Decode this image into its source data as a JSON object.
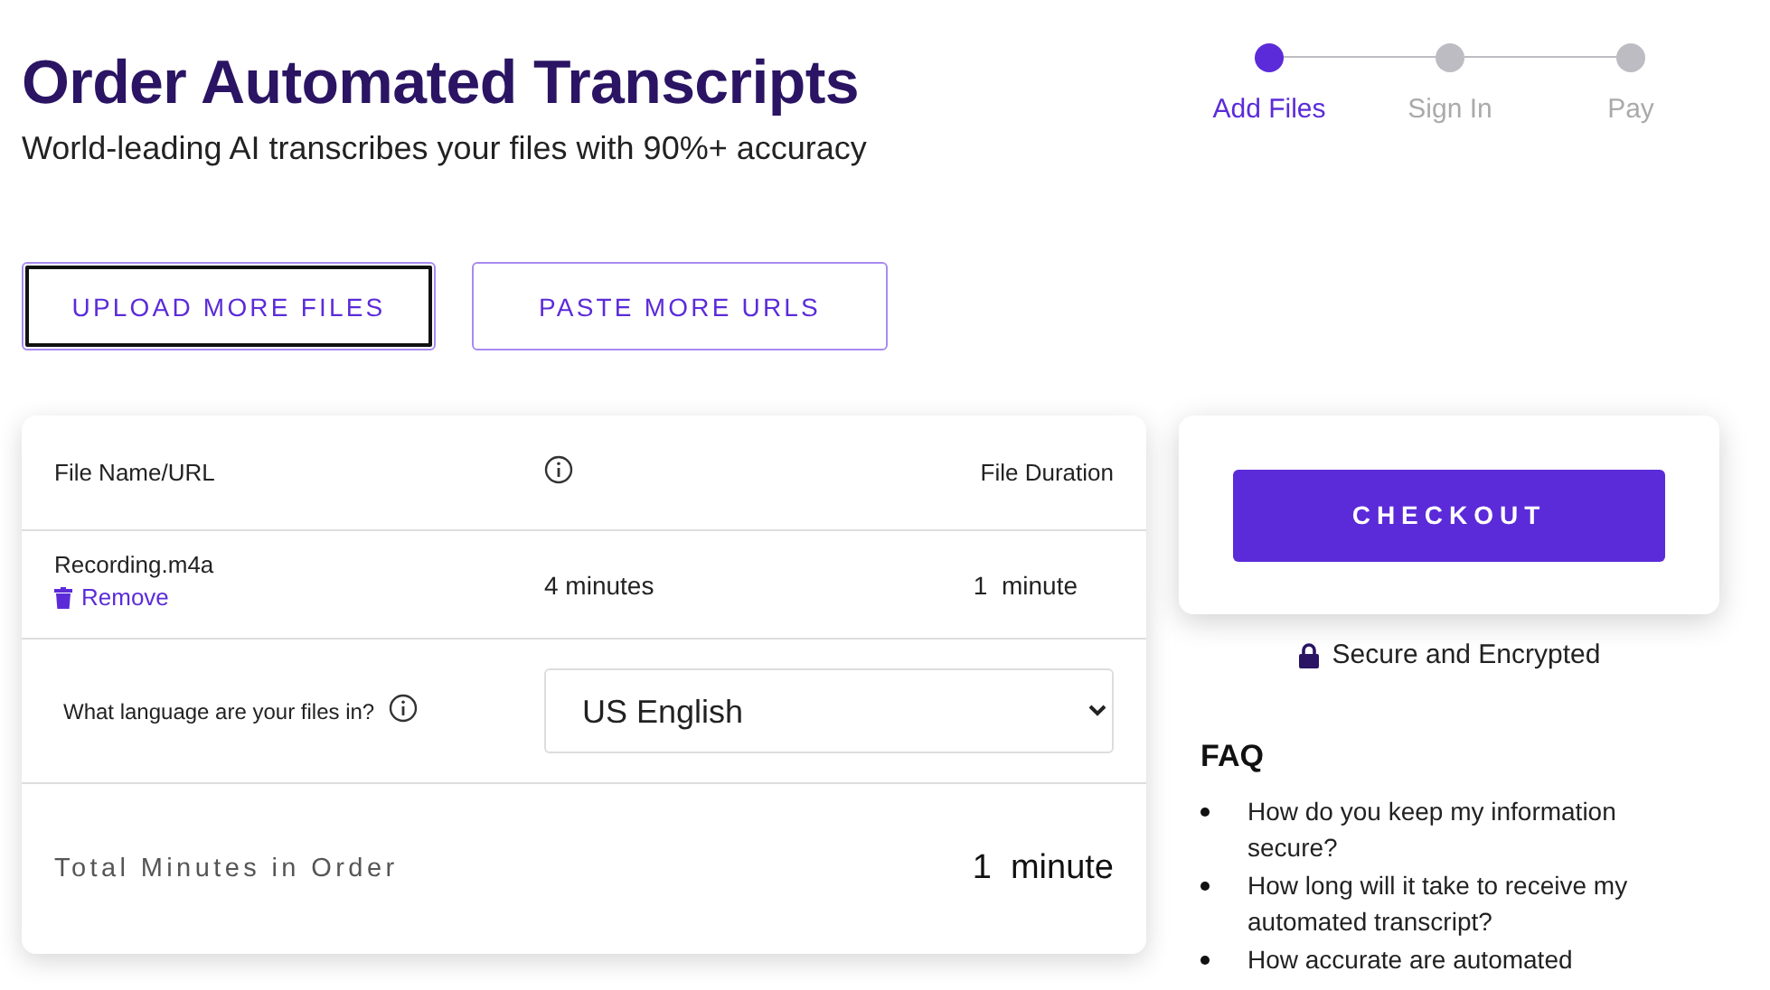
{
  "header": {
    "title": "Order Automated Transcripts",
    "subtitle": "World-leading AI transcribes your files with 90%+ accuracy"
  },
  "steps": [
    {
      "label": "Add Files",
      "active": true
    },
    {
      "label": "Sign In",
      "active": false
    },
    {
      "label": "Pay",
      "active": false
    }
  ],
  "actions": [
    {
      "label": "UPLOAD MORE FILES",
      "focused": true
    },
    {
      "label": "PASTE MORE URLS",
      "focused": false
    }
  ],
  "table": {
    "columns": [
      "File Name/URL",
      "File Duration"
    ],
    "rows": [
      {
        "file": "Recording.m4a",
        "action": "Remove",
        "length": "4 minutes",
        "duration": "1  minute"
      }
    ]
  },
  "language": {
    "label": "What language are your files in?",
    "value": "US English"
  },
  "total": {
    "label": "Total Minutes in Order",
    "value": "1  minute"
  },
  "checkout": {
    "button": "CHECKOUT",
    "security": "Secure and Encrypted"
  },
  "faq": {
    "title": "FAQ",
    "items": [
      "How do you keep my information secure?",
      "How long will it take to receive my automated transcript?",
      "How accurate are automated"
    ]
  }
}
